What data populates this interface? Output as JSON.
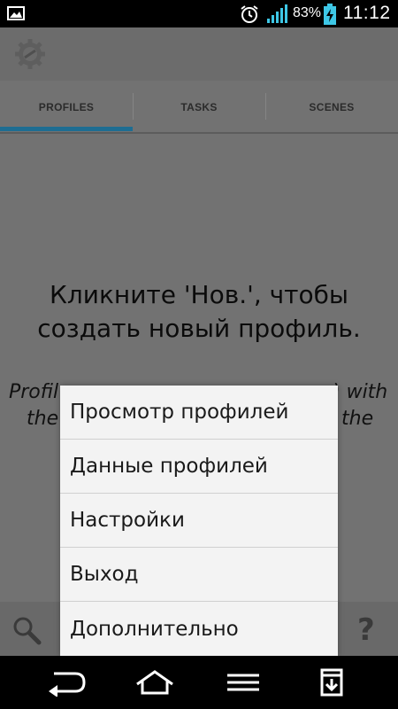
{
  "statusbar": {
    "battery_percent": "83%",
    "time": "11:12",
    "icons": [
      "gallery-icon",
      "alarm-icon",
      "signal-icon",
      "battery-charging-icon"
    ]
  },
  "tabs": [
    {
      "label": "PROFILES",
      "selected": true
    },
    {
      "label": "TASKS",
      "selected": false
    },
    {
      "label": "SCENES",
      "selected": false
    }
  ],
  "empty_state": {
    "title_line1": "Кликните 'Нов.', чтобы",
    "title_line2": "создать новый профиль.",
    "hint_line1_left": "Profil",
    "hint_line1_right": ") with",
    "hint_line2_left": "the",
    "hint_line2_right": "the"
  },
  "menu": {
    "items": [
      {
        "label": "Просмотр профилей"
      },
      {
        "label": "Данные профилей"
      },
      {
        "label": "Настройки"
      },
      {
        "label": "Выход"
      },
      {
        "label": "Дополнительно"
      }
    ]
  },
  "bottombar": {
    "help_label": "?"
  },
  "colors": {
    "accent": "#1e6d92",
    "menu_bg": "#f3f3f3",
    "dim_bg": "#727272"
  }
}
